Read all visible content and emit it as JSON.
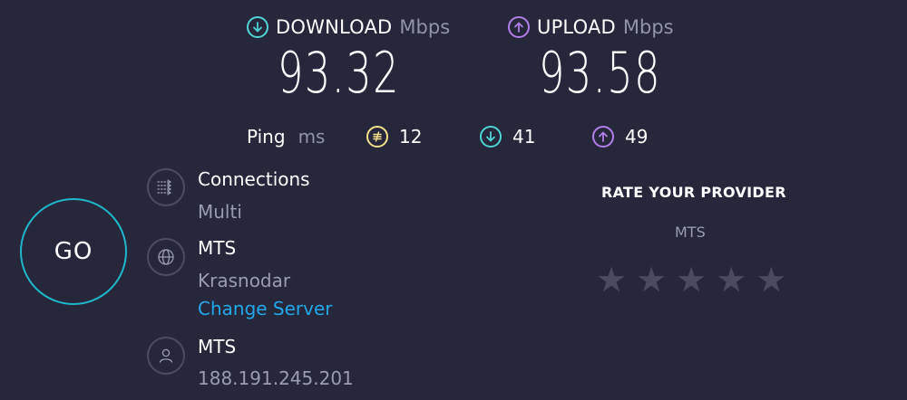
{
  "download": {
    "label": "DOWNLOAD",
    "unit": "Mbps",
    "value": "93.32",
    "icon": "arrow-down-circle-icon"
  },
  "upload": {
    "label": "UPLOAD",
    "unit": "Mbps",
    "value": "93.58",
    "icon": "arrow-up-circle-icon"
  },
  "ping": {
    "label": "Ping",
    "unit": "ms",
    "idle": "12",
    "download": "41",
    "upload": "49"
  },
  "go_button": {
    "label": "GO"
  },
  "connections": {
    "title": "Connections",
    "value": "Multi"
  },
  "server": {
    "name": "MTS",
    "location": "Krasnodar",
    "change_label": "Change Server"
  },
  "provider": {
    "name": "MTS",
    "ip": "188.191.245.201"
  },
  "rate": {
    "title": "RATE YOUR PROVIDER",
    "isp": "MTS",
    "stars": 5,
    "filled": 0
  },
  "colors": {
    "background": "#26273b",
    "download_accent": "#4fd3d5",
    "upload_accent": "#b27ee8",
    "ping_accent": "#f2e08a",
    "link": "#24a7e8",
    "go_ring": "#1fb6c9"
  }
}
